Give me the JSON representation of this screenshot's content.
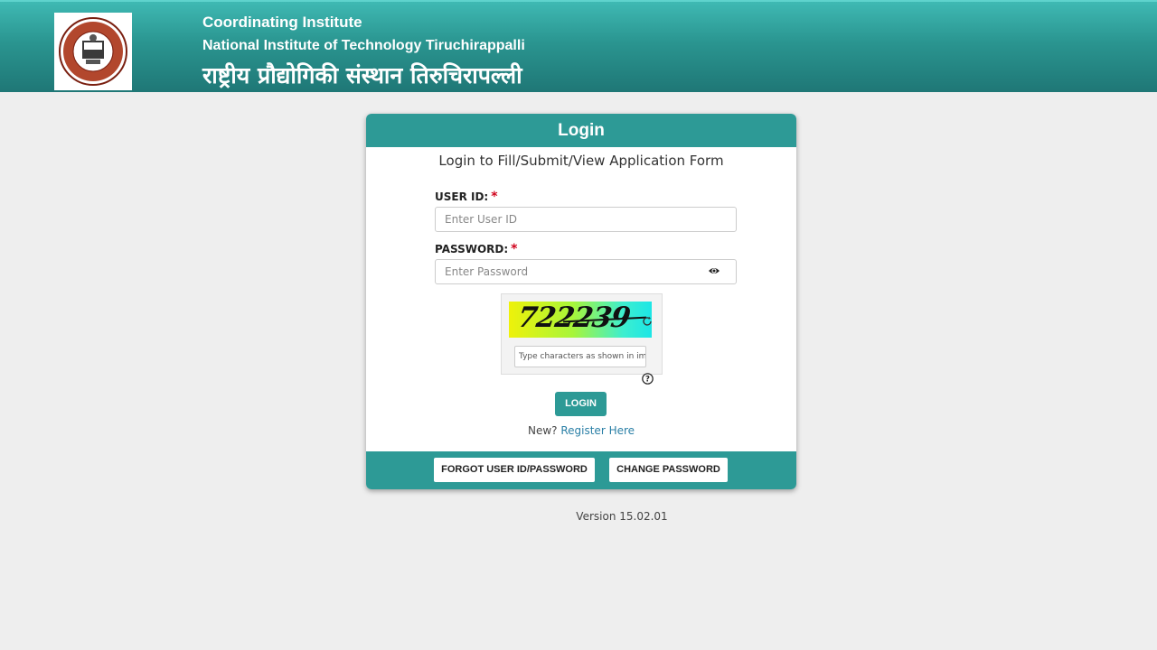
{
  "header": {
    "line1": "Coordinating Institute",
    "line2": "National Institute of Technology Tiruchirappalli",
    "line3": "राष्ट्रीय प्रौद्योगिकी संस्थान तिरुचिरापल्ली",
    "logo_icon": "nit-trichy-emblem-icon",
    "bg_color": "#2a9590"
  },
  "login": {
    "title": "Login",
    "subtitle": "Login to Fill/Submit/View Application Form",
    "user_id_label": "USER ID:",
    "user_id_placeholder": "Enter User ID",
    "password_label": "PASSWORD:",
    "password_placeholder": "Enter Password",
    "required_marker": "*",
    "captcha_text": "722239",
    "captcha_placeholder": "Type characters as shown in image",
    "login_button": "LOGIN",
    "new_text": "New?",
    "register_link": "Register Here",
    "accent_color": "#2d9a96"
  },
  "footer_buttons": {
    "forgot": "FORGOT USER ID/PASSWORD",
    "change_password": "CHANGE PASSWORD"
  },
  "version": "Version 15.02.01"
}
